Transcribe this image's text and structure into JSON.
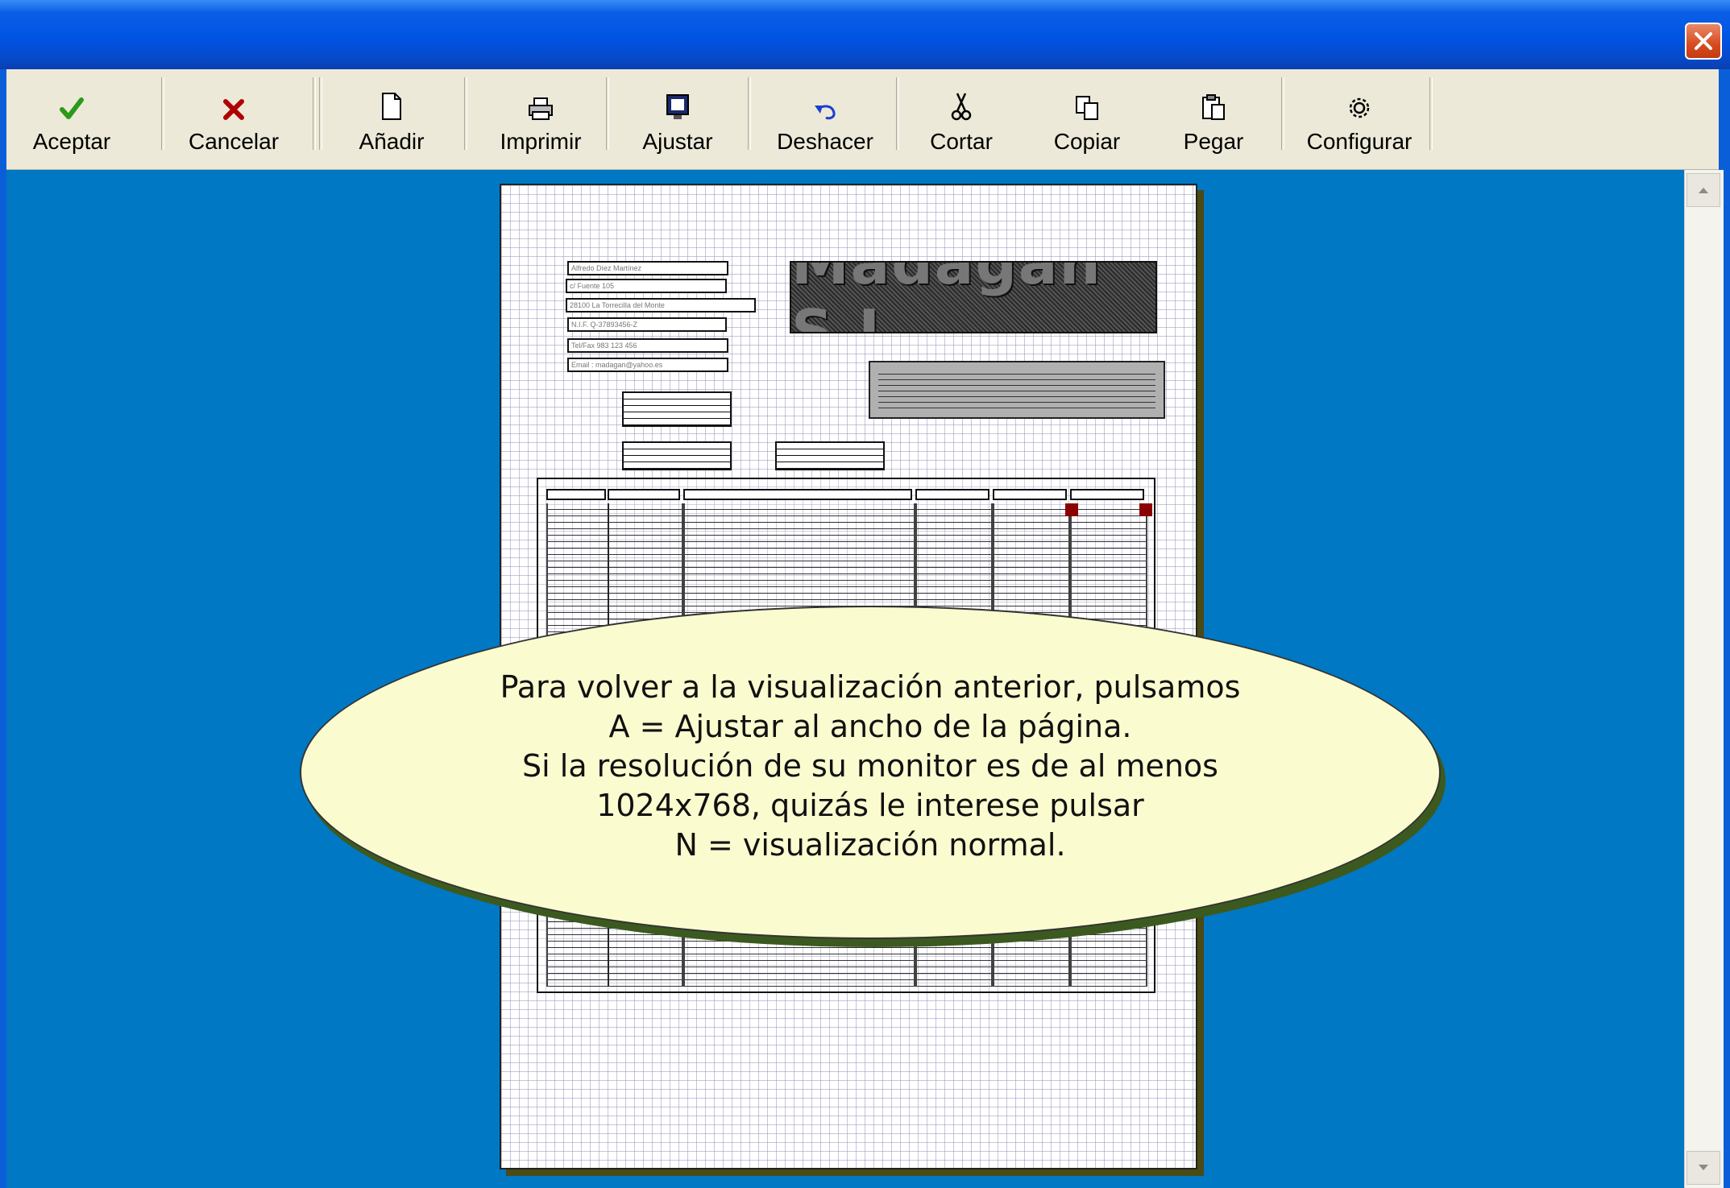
{
  "window": {
    "title": ""
  },
  "toolbar": {
    "buttons": [
      {
        "id": "aceptar",
        "label": "Aceptar",
        "icon": "check-icon"
      },
      {
        "id": "cancelar",
        "label": "Cancelar",
        "icon": "x-icon"
      },
      {
        "id": "anadir",
        "label": "Añadir",
        "icon": "new-page-icon"
      },
      {
        "id": "imprimir",
        "label": "Imprimir",
        "icon": "printer-icon"
      },
      {
        "id": "ajustar",
        "label": "Ajustar",
        "icon": "monitor-icon"
      },
      {
        "id": "deshacer",
        "label": "Deshacer",
        "icon": "undo-icon"
      },
      {
        "id": "cortar",
        "label": "Cortar",
        "icon": "scissors-icon"
      },
      {
        "id": "copiar",
        "label": "Copiar",
        "icon": "copy-icon"
      },
      {
        "id": "pegar",
        "label": "Pegar",
        "icon": "paste-icon"
      },
      {
        "id": "configurar",
        "label": "Configurar",
        "icon": "gear-icon"
      }
    ]
  },
  "document": {
    "sender_fields": [
      "Alfredo Díez Martínez",
      "c/ Fuente 105",
      "28100 La Torrecilla del Monte",
      "N.I.F. Q-37893456-Z",
      "Tel/Fax 983 123 456",
      "Email : madagan@yahoo.es"
    ],
    "logo_text": "Madagan S.L."
  },
  "callout": {
    "lines": [
      "Para volver a la visualización anterior, pulsamos",
      "A = Ajustar al ancho de la página.",
      "Si la resolución de su monitor es de al menos",
      "1024x768, quizás le interese pulsar",
      "N = visualización normal."
    ]
  },
  "colors": {
    "titlebar": "#0054e3",
    "toolbar": "#ece9d8",
    "workspace": "#0078c4",
    "callout_fill": "#fbfbd0",
    "check_green": "#2a9a1a",
    "cancel_red": "#b00000"
  }
}
